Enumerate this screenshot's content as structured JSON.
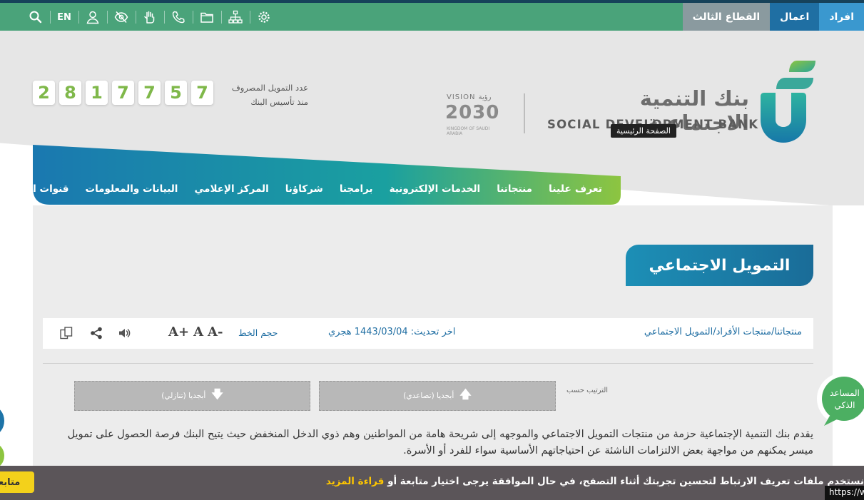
{
  "topbar": {
    "tabs": [
      "القطاع الثالث",
      "اعمال",
      "افراد"
    ],
    "lang": "EN",
    "icons": [
      "search-icon",
      "language-toggle",
      "user-icon",
      "eye-slash-icon",
      "sign-language-icon",
      "phone-icon",
      "folder-icon",
      "sitemap-icon",
      "settings-gear-icon"
    ]
  },
  "counter": {
    "label_line1": "عدد التمويل المصروف",
    "label_line2": "منذ تأسيس البنك",
    "digits": [
      "2",
      "8",
      "1",
      "7",
      "7",
      "5",
      "7"
    ]
  },
  "vision": {
    "label": "VISION رؤية",
    "year": "2030",
    "country": "KINGDOM OF SAUDI ARABIA"
  },
  "brand": {
    "name_ar": "بنك التنمية الاجتماعية",
    "name_en": "SOCIAL DEVELOPMENT BANK",
    "home_tooltip": "الصفحة الرئيسية"
  },
  "nav": {
    "items": [
      "تعرف علينا",
      "منتجاتنا",
      "الخدمات الإلكترونية",
      "برامجنا",
      "شركاؤنا",
      "المركز الإعلامي",
      "البيانات والمعلومات",
      "قنوات التواصل"
    ]
  },
  "page": {
    "title": "التمويل الاجتماعي",
    "breadcrumb": "منتجاتنا/منتجات الأفراد/التمويل الاجتماعي",
    "updated": "اخر تحديث: 1443/03/04 هجري",
    "font_size_label": "حجم الخط",
    "font_controls": [
      "A+",
      "A",
      "A-"
    ],
    "sort_label": "الترتيب حسب",
    "sort_asc": "أبجديا (تصاعدي)",
    "sort_desc": "أبجديا (تنازلي)",
    "description": "يقدم بنك التنمية الإجتماعية حزمة من منتجات التمويل الاجتماعي والموجهه إلى شريحة هامة من المواطنين وهم ذوي الدخل المنخفض حيث يتيح البنك فرصة الحصول على تمويل ميسر يمكنهم من مواجهة بعض الالتزامات الناشئة عن احتياجاتهم الأساسية سواء للفرد أو الأسرة."
  },
  "assistant": {
    "line1": "المساعد",
    "line2": "الذكي"
  },
  "cookie": {
    "text": "نستخدم ملفات تعريف الارتباط لتحسين تجربتك أثناء التصفح، في حال الموافقة يرجى اختيار متابعة أو",
    "more": "قراءة المزيد",
    "button": "متابعة"
  },
  "status_url": "https://w",
  "colors": {
    "topbar_green": "#4aa37a",
    "nav_blue": "#1a7fb3",
    "nav_green": "#8dc540",
    "counter_green": "#7fb84a",
    "link_blue": "#1e6da2"
  }
}
